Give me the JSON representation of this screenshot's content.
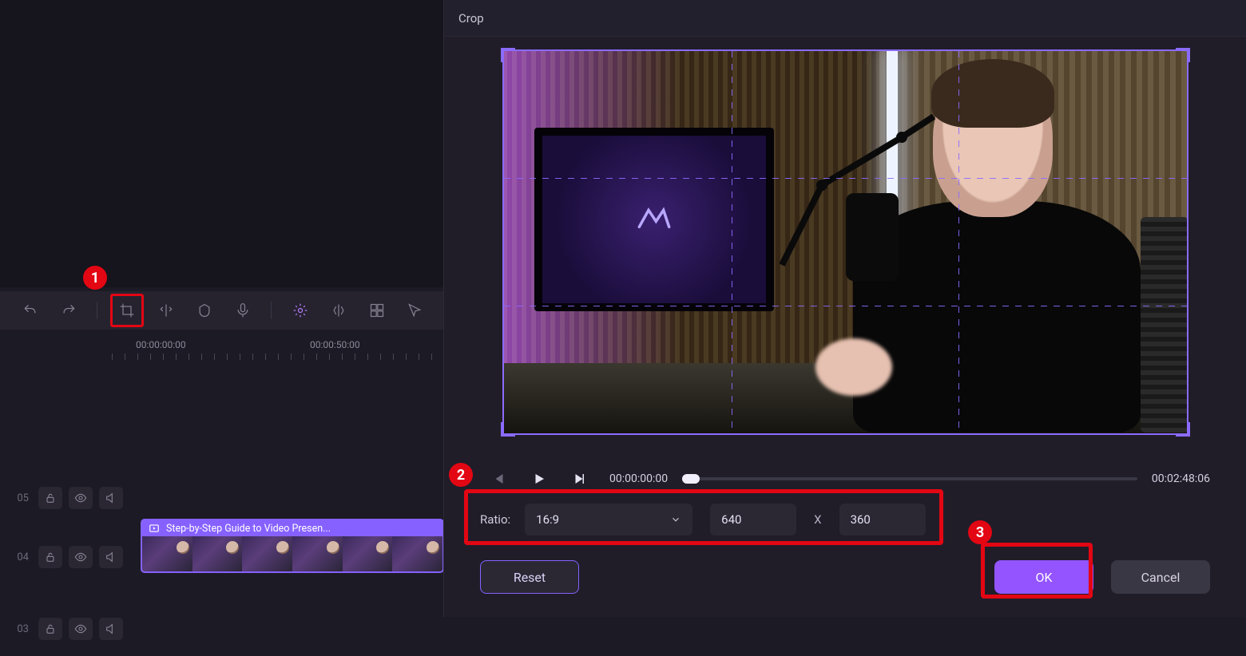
{
  "annotations": {
    "badge1": "1",
    "badge2": "2",
    "badge3": "3"
  },
  "toolbar": {
    "active": "crop"
  },
  "time_ruler": {
    "t0": "00:00:00:00",
    "t1": "00:00:50:00"
  },
  "tracks": {
    "row05": "05",
    "row04": "04",
    "row03": "03"
  },
  "clip": {
    "title": "Step-by-Step Guide to Video Presen..."
  },
  "crop": {
    "title": "Crop",
    "play_time": "00:00:00:00",
    "duration": "00:02:48:06",
    "ratio_label": "Ratio:",
    "ratio_value": "16:9",
    "width": "640",
    "x_sep": "X",
    "height": "360",
    "buttons": {
      "reset": "Reset",
      "ok": "OK",
      "cancel": "Cancel"
    }
  }
}
